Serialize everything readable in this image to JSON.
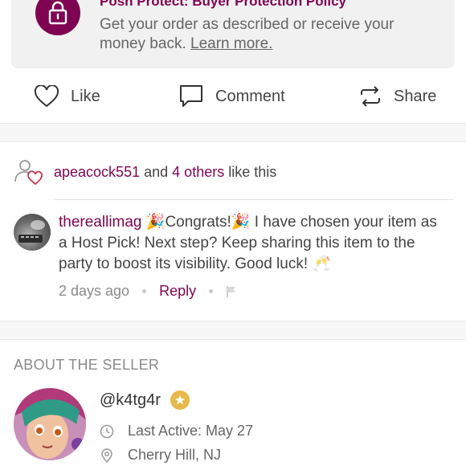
{
  "protect": {
    "title": "Posh Protect: Buyer Protection Policy",
    "text": "Get your order as described or receive your money back.",
    "link": "Learn more."
  },
  "actions": {
    "like": "Like",
    "comment": "Comment",
    "share": "Share"
  },
  "likes": {
    "user": "apeacock551",
    "and": "and",
    "others": "4 others",
    "suffix": "like this"
  },
  "comment": {
    "username": "thereallimag",
    "text_part1": "Congrats!",
    "text_part2": " I have chosen your item as a Host Pick! Next step? Keep sharing this item to the party to boost its visibility. Good luck!",
    "emoji_party": "🎉",
    "emoji_cheers": "🥂",
    "time": "2 days ago",
    "reply": "Reply"
  },
  "about": {
    "title": "ABOUT THE SELLER",
    "handle": "@k4tg4r",
    "last_active": "Last Active: May 27",
    "location": "Cherry Hill, NJ"
  },
  "colors": {
    "brand": "#7f0353",
    "badge": "#e8b94a"
  },
  "icons": [
    "lock-icon",
    "heart-icon",
    "comment-icon",
    "share-icon",
    "likes-user-heart-icon",
    "flag-icon",
    "star-icon",
    "clock-icon",
    "location-pin-icon"
  ]
}
